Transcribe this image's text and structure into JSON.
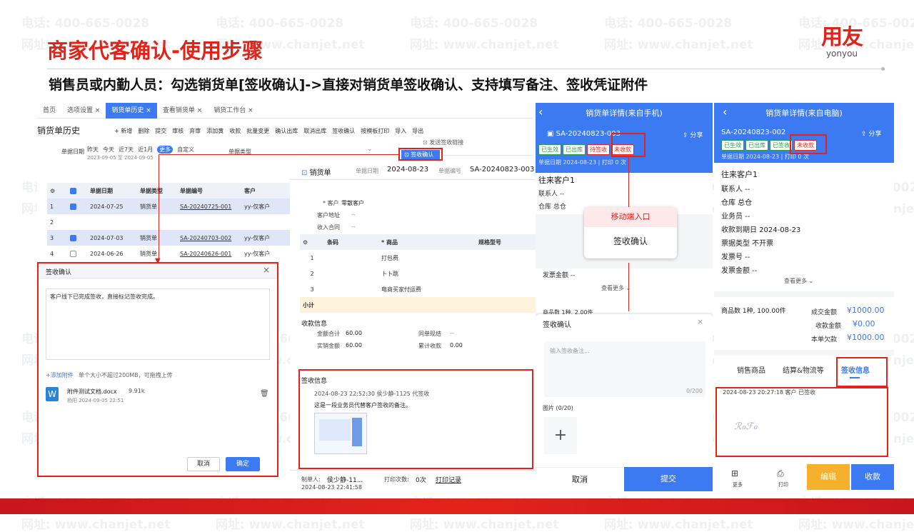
{
  "watermark": {
    "phone": "电话: 400-665-0028",
    "site": "网址: www.chanjet.net"
  },
  "slide": {
    "title": "商家代客确认-使用步骤",
    "subtitle": "销售员或内勤人员：勾选销货单[签收确认]->直接对销货单签收确认、支持填写备注、签收凭证附件"
  },
  "logo": {
    "cn": "用友",
    "en": "yonyou"
  },
  "history": {
    "tabs": [
      "首页",
      "选项设置 ×",
      "销货单历史 ×",
      "查看销货单 ×",
      "销货工作台 ×"
    ],
    "page_title": "销货单历史",
    "toolbar": [
      "+ 新增",
      "删除",
      "提交",
      "审核",
      "弃审",
      "添加黄",
      "收款",
      "批量变更",
      "确认出库",
      "取消出库",
      "签收确认",
      "按模板打印",
      "导入",
      "导出"
    ],
    "send_link": "发送签收链接",
    "sign_btn": "签收确认",
    "date_label": "单据日期",
    "quick": [
      "昨天",
      "今天",
      "近7天",
      "近1月"
    ],
    "more": "更多",
    "custom": "自定义",
    "date_range": "2023-09-05 至 2024-09-05",
    "type_label": "单据类型",
    "cols": [
      "",
      "",
      "单据日期",
      "单据类型",
      "单据编号",
      "客户"
    ],
    "rows": [
      {
        "n": "1",
        "date": "2024-07-25",
        "type": "销货单",
        "no": "SA-20240725-001",
        "cust": "yy-仅客户",
        "on": true
      },
      {
        "n": "2",
        "date": "",
        "type": "",
        "no": "",
        "cust": "",
        "on": false
      },
      {
        "n": "3",
        "date": "2024-07-03",
        "type": "销货单",
        "no": "SA-20240703-002",
        "cust": "yy-仅客户",
        "on": true
      },
      {
        "n": "4",
        "date": "2024-06-26",
        "type": "销货单",
        "no": "SA-20240626-001",
        "cust": "yy-仅客户",
        "on": false
      }
    ]
  },
  "dialog": {
    "title": "签收确认",
    "text": "客户线下已完成签收，直接标记签收完成。",
    "add_attach": "+添加附件",
    "hint": "单个大小不超过200MB，可拖拽上传",
    "file_name": "附件测试文档.docx",
    "file_size": "9.91k",
    "file_meta": "杨阳  2024-09-05 22:51",
    "cancel": "取消",
    "ok": "确定"
  },
  "detail": {
    "tab": "销货单",
    "date_label": "单据日期",
    "date": "2024-08-23",
    "no_label": "单据编号",
    "no": "SA-20240823-003",
    "customer_label": "* 客户",
    "customer": "零散客户",
    "addr_label": "客户地址",
    "addr": "--",
    "contract_label": "收入合同",
    "contract": "--",
    "cols": [
      "",
      "条码",
      "* 商品",
      "规格型号"
    ],
    "items": [
      {
        "n": "1",
        "name": "打包费"
      },
      {
        "n": "2",
        "name": "卜卜跳"
      },
      {
        "n": "3",
        "name": "电商买家付运费"
      }
    ],
    "subtotal": "小计",
    "pay_title": "收款信息",
    "total_label": "金额合计",
    "total": "60.00",
    "rule_label": "同单现结",
    "rule": "--",
    "actual_label": "实销金额",
    "actual": "60.00",
    "acc_label": "累计收款",
    "acc": "0.00",
    "sign_title": "签收信息",
    "sign_line": "2024-08-23 22:52:30  侯少静-1125  代签收",
    "sign_note": "这是一段业务员代替客户签收的备注。",
    "maker_label": "制单人:",
    "maker": "侯少静-11...",
    "print_label": "打印次数:",
    "print": "0次",
    "print_rec": "打印记录",
    "maker_time": "2024-08-23 22:41:58"
  },
  "phone1": {
    "title": "销货单详情(来自手机)",
    "no": "SA-20240823-003",
    "share": "分享",
    "tags": [
      "已生效",
      "已出库",
      "待签收",
      "未收款"
    ],
    "meta": "单据日期  2024-08-23 | 打印 0 次",
    "customer": "往来客户1",
    "contact": "联系人 --",
    "wh": "仓库 总仓",
    "callout": "移动端入口",
    "sign_btn": "签收确认",
    "invoice": "发票金额 --",
    "more": "查看更多",
    "goods": "商品数  1种, 2.00件",
    "dlg_title": "签收确认",
    "placeholder": "输入签收备注...",
    "count": "0/200",
    "pic": "图片 (0/20)",
    "cancel": "取消",
    "submit": "提交"
  },
  "phone2": {
    "title": "销货单详情(来自电脑)",
    "no": "SA-20240823-002",
    "share": "分享",
    "tags": [
      "已生效",
      "已出库",
      "已签收",
      "未收款"
    ],
    "meta": "单据日期  2024-08-23 | 打印 0 次",
    "fields": [
      "往来客户1",
      "联系人 --",
      "仓库 总仓",
      "业务员 --",
      "收款到期日 2024-08-23",
      "票据类型 不开票",
      "发票号 --",
      "发票金额 --"
    ],
    "more": "查看更多",
    "goods": "商品数  1种, 100.00件",
    "amt1_label": "成交金额",
    "amt1": "¥1000.00",
    "amt2_label": "收款金额",
    "amt2": "¥0.00",
    "amt3_label": "本单欠款",
    "amt3": "¥1000.00",
    "tabs": [
      "销售商品",
      "结算&物流等",
      "签收信息"
    ],
    "sign_line": "2024-08-23 20:27:18  客户  已签收",
    "bottom": [
      "更多",
      "打印",
      "编辑",
      "收款"
    ]
  }
}
